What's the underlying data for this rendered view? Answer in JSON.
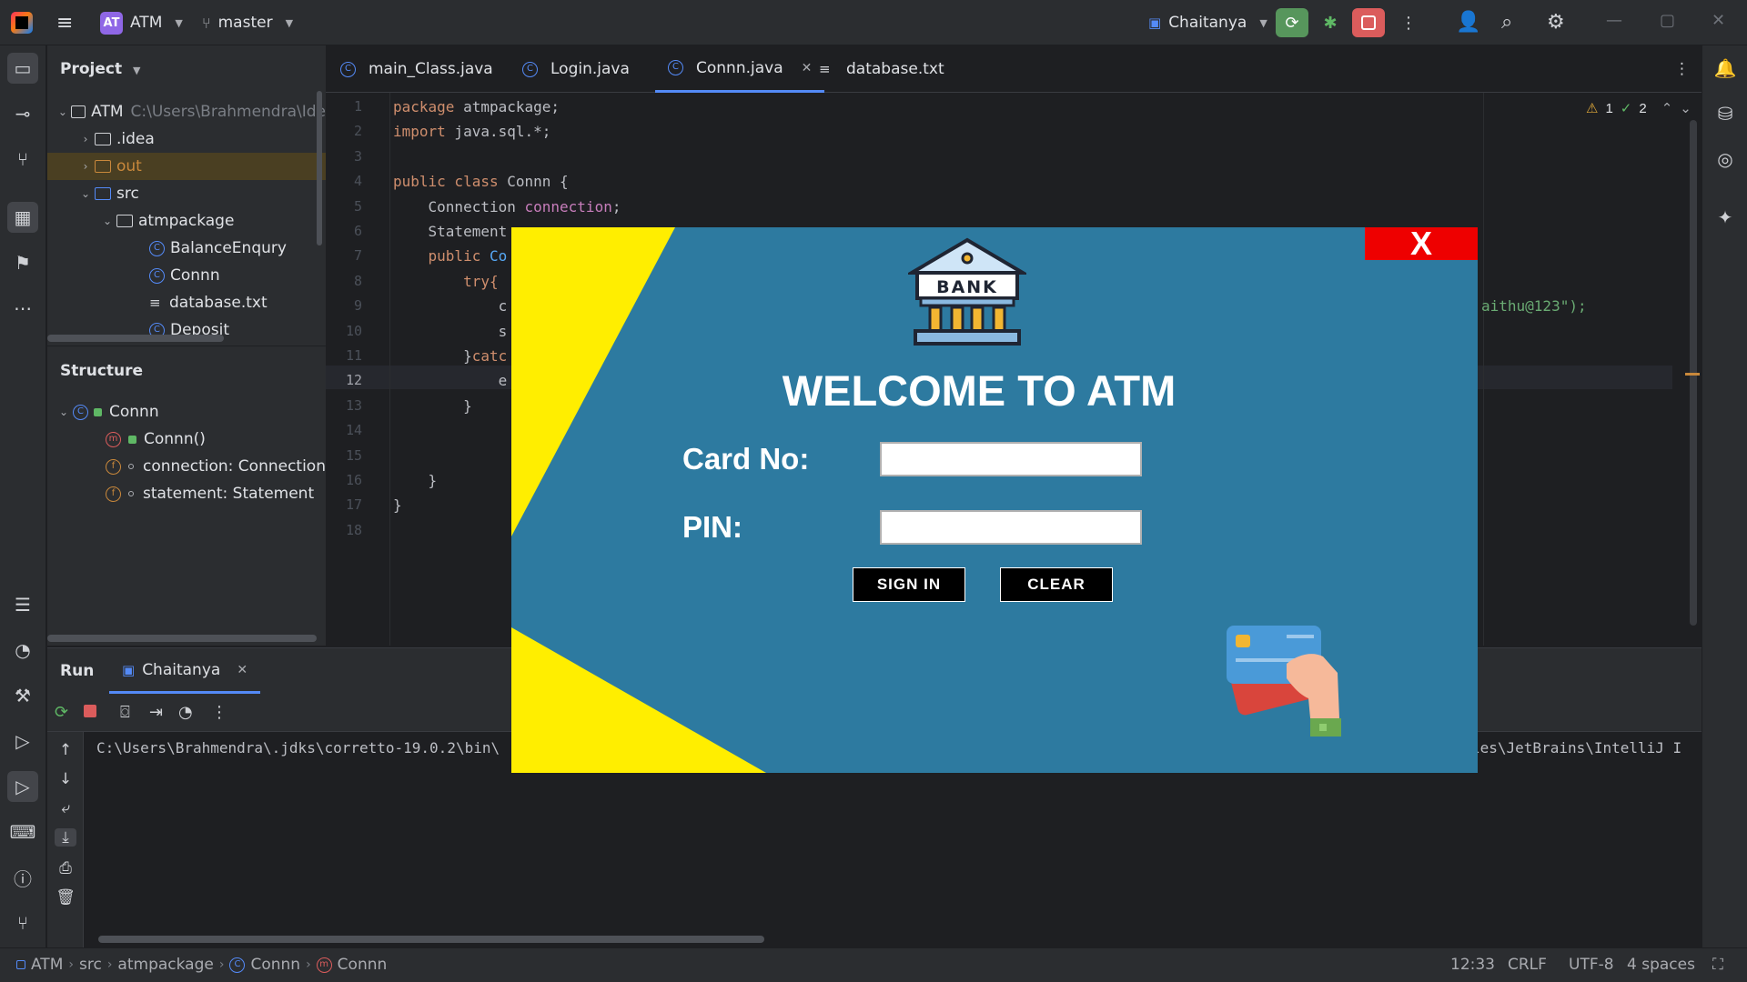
{
  "titlebar": {
    "project_badge": "AT",
    "project_name": "ATM",
    "branch": "master",
    "run_config": "Chaitanya"
  },
  "project_panel": {
    "title": "Project",
    "root_name": "ATM",
    "root_path": "C:\\Users\\Brahmendra\\Ide",
    "items": [
      {
        "label": ".idea"
      },
      {
        "label": "out"
      },
      {
        "label": "src"
      },
      {
        "label": "atmpackage"
      },
      {
        "label": "BalanceEnqury"
      },
      {
        "label": "Connn"
      },
      {
        "label": "database.txt"
      },
      {
        "label": "Deposit"
      }
    ]
  },
  "structure": {
    "title": "Structure",
    "class_name": "Connn",
    "members": [
      {
        "icon": "m",
        "label": "Connn()"
      },
      {
        "icon": "f",
        "label": "connection: Connection"
      },
      {
        "icon": "f",
        "label": "statement: Statement"
      }
    ]
  },
  "editor": {
    "tabs": [
      {
        "label": "main_Class.java"
      },
      {
        "label": "Login.java"
      },
      {
        "label": "Connn.java"
      },
      {
        "label": "database.txt"
      }
    ],
    "active_tab": "Connn.java",
    "line_numbers": [
      "1",
      "2",
      "3",
      "4",
      "5",
      "6",
      "7",
      "8",
      "9",
      "10",
      "11",
      "12",
      "13",
      "14",
      "15",
      "16",
      "17",
      "18"
    ],
    "current_line": "12",
    "code": {
      "l1_kw": "package",
      "l1_rest": " atmpackage;",
      "l2_kw": "import",
      "l2_rest": " java.sql.*;",
      "l4_kw": "public class",
      "l4_rest": " Connn {",
      "l5_a": "    Connection ",
      "l5_fld": "connection",
      "l5_b": ";",
      "l6": "    Statement",
      "l7_kw": "    public",
      "l7_rest": " Co",
      "l8": "        try{",
      "l9": "            c",
      "l9_right": "aithu@123\");",
      "l10": "            s",
      "l11_a": "        }",
      "l11_kw": "catc",
      "l12": "            e",
      "l13": "        }",
      "l16": "    }",
      "l17": "}"
    },
    "warnings": "1",
    "checks": "2"
  },
  "run_panel": {
    "run_label": "Run",
    "config_tab": "Chaitanya",
    "console_left": "C:\\Users\\Brahmendra\\.jdks\\corretto-19.0.2\\bin\\",
    "console_right": "les\\JetBrains\\IntelliJ I"
  },
  "statusbar": {
    "crumbs": [
      "ATM",
      "src",
      "atmpackage",
      "Connn",
      "Connn"
    ],
    "position": "12:33",
    "line_sep": "CRLF",
    "encoding": "UTF-8",
    "indent": "4 spaces"
  },
  "atm_dialog": {
    "close_label": "X",
    "bank_sign": "BANK",
    "title": "WELCOME TO ATM",
    "card_label": "Card No:",
    "pin_label": "PIN:",
    "card_value": "",
    "pin_value": "",
    "signin_label": "SIGN IN",
    "clear_label": "CLEAR",
    "colors": {
      "background": "#2d7aa0",
      "accent_yellow": "#ffee00",
      "close": "#ee0000"
    }
  }
}
